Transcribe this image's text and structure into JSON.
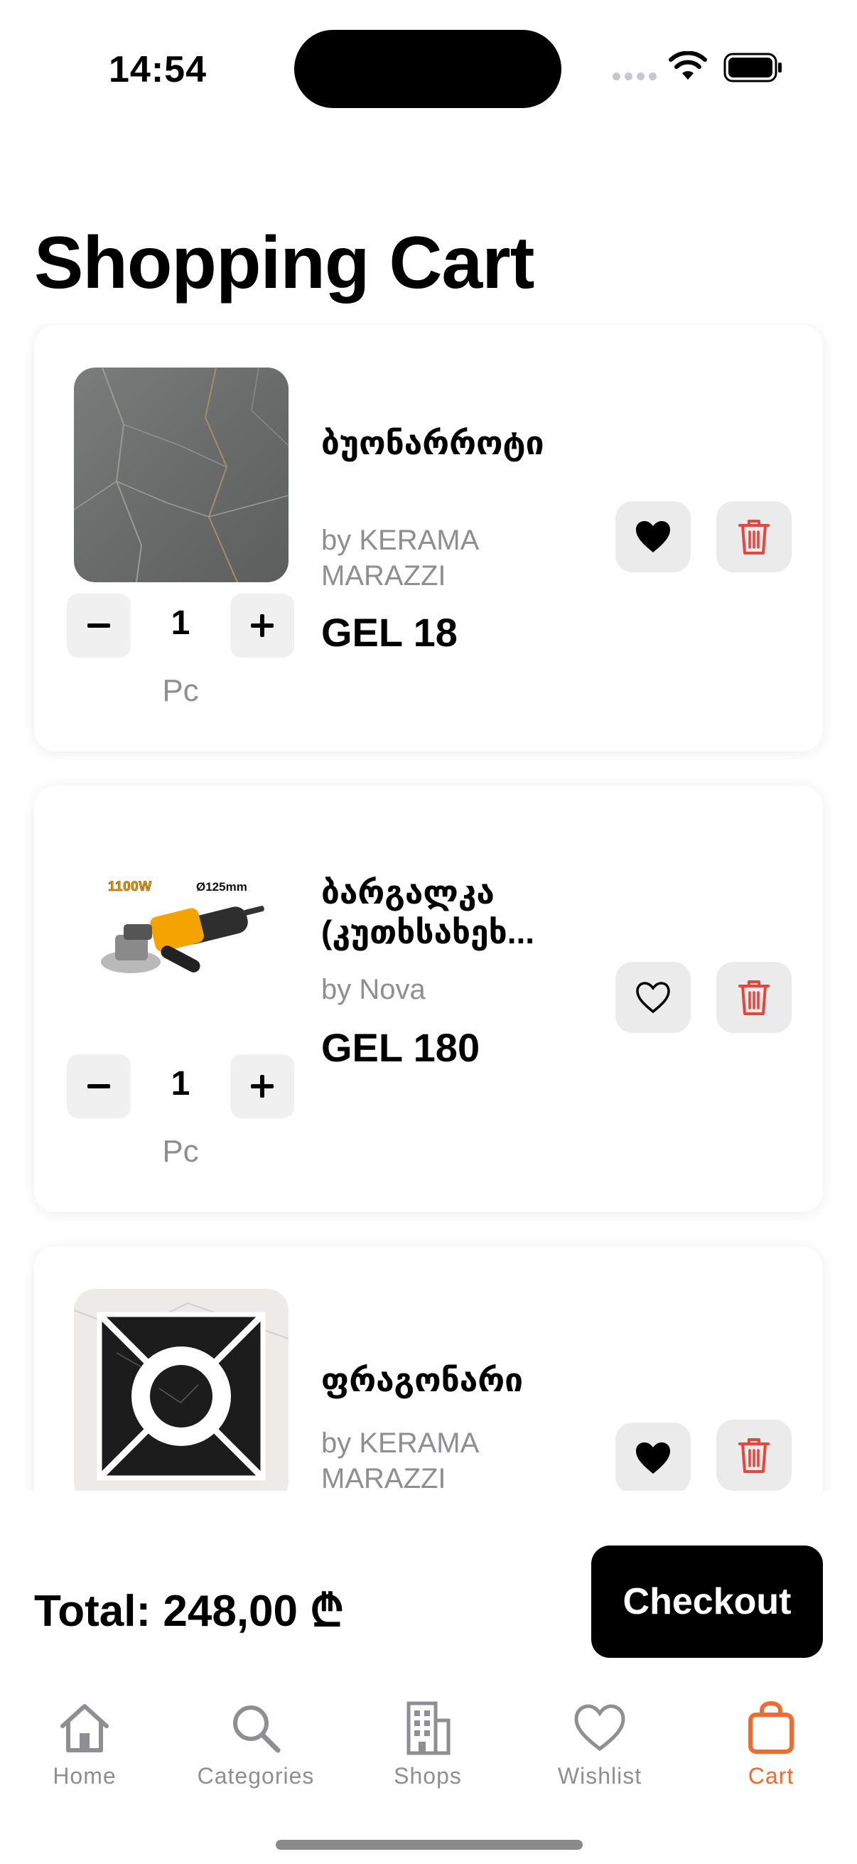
{
  "status_bar": {
    "time": "14:54"
  },
  "page": {
    "title": "Shopping Cart"
  },
  "cart": {
    "items": [
      {
        "name": "ბუონარროტი",
        "brand": "by KERAMA MARAZZI",
        "price": "GEL 18",
        "quantity": "1",
        "unit": "Pc",
        "wishlisted": true
      },
      {
        "name": "ბარგალკა (კუთხსახეხ...",
        "brand": "by Nova",
        "price": "GEL 180",
        "quantity": "1",
        "unit": "Pc",
        "wishlisted": false,
        "image_text": {
          "power": "1100W",
          "diameter": "Ø125mm"
        }
      },
      {
        "name": "ფრაგონარი",
        "brand": "by KERAMA MARAZZI",
        "price": "",
        "quantity": "",
        "unit": "",
        "wishlisted": true
      }
    ]
  },
  "summary": {
    "total": "Total: 248,00 ₾",
    "checkout_label": "Checkout"
  },
  "tab_bar": {
    "tabs": [
      {
        "label": "Home",
        "icon": "home-icon"
      },
      {
        "label": "Categories",
        "icon": "search-icon"
      },
      {
        "label": "Shops",
        "icon": "building-icon"
      },
      {
        "label": "Wishlist",
        "icon": "heart-icon"
      },
      {
        "label": "Cart",
        "icon": "bag-icon",
        "active": true
      }
    ]
  },
  "colors": {
    "accent": "#f26a2e",
    "delete": "#e8453c",
    "secondary_text": "#8e8e93"
  }
}
